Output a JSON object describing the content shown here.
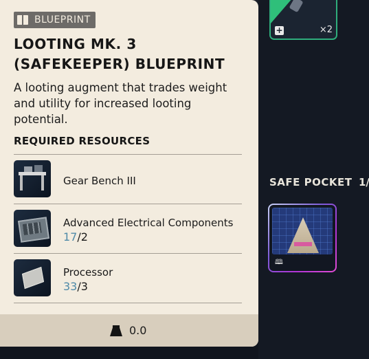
{
  "tooltip": {
    "tag_label": "BLUEPRINT",
    "title_line1": "LOOTING MK. 3",
    "title_line2": "(SAFEKEEPER) BLUEPRINT",
    "description": "A looting augment that trades weight and utility for increased looting potential.",
    "required_header": "REQUIRED RESOURCES",
    "resources": [
      {
        "name": "Gear Bench III",
        "have": "",
        "need": "",
        "icon": "gear-bench-icon"
      },
      {
        "name": "Advanced Electrical Components",
        "have": "17",
        "need": "/2",
        "icon": "electrical-components-icon"
      },
      {
        "name": "Processor",
        "have": "33",
        "need": "/3",
        "icon": "processor-icon"
      }
    ],
    "weight": "0.0",
    "colors": {
      "have_qty": "#4f8aa8",
      "panel_bg": "#f3ecdf"
    }
  },
  "inventory": {
    "top_item_count": "×2",
    "safe_pocket_label": "SAFE POCKET",
    "safe_pocket_count": "1/",
    "colors": {
      "top_item_rarity": "#2fbf7a",
      "safe_slot_rarity": "#b234d6"
    }
  }
}
